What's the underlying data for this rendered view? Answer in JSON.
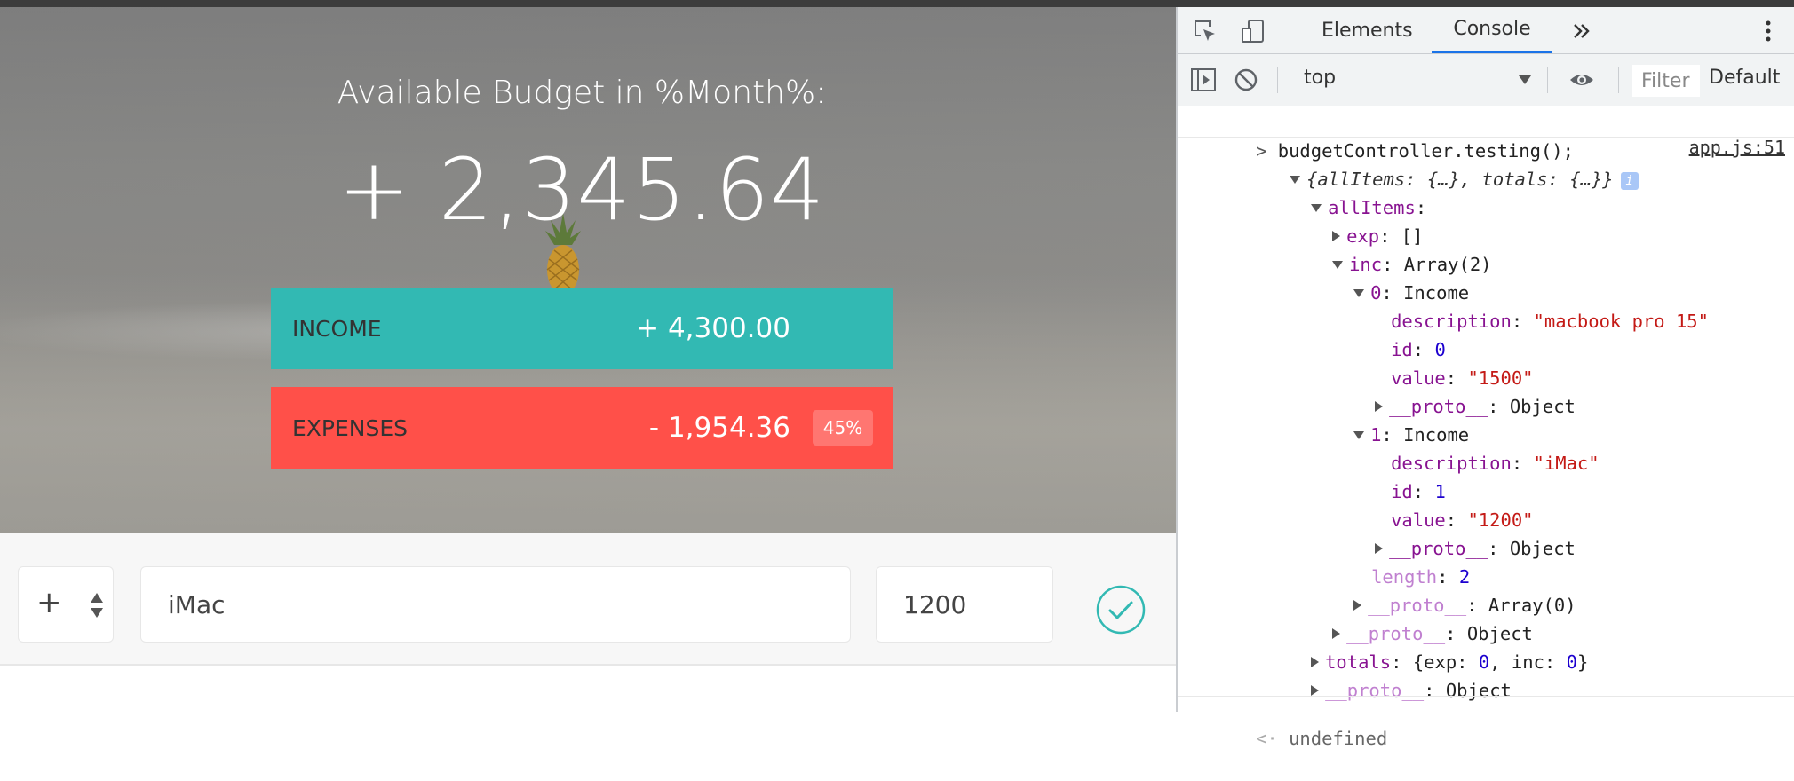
{
  "app": {
    "title": "Available Budget in %Month%:",
    "budget": "+ 2,345.64",
    "income": {
      "label": "Income",
      "value": "+ 4,300.00"
    },
    "expenses": {
      "label": "Expenses",
      "value": "- 1,954.36",
      "percentage": "45%"
    },
    "add": {
      "type_value": "+",
      "description_value": "iMac",
      "amount_value": "1200"
    },
    "colors": {
      "income": "#32b9b3",
      "expenses": "#ff5049"
    }
  },
  "devtools": {
    "tabs": [
      "Elements",
      "Console"
    ],
    "active_tab": "Console",
    "more_tabs_icon": "double-chevron-icon",
    "context": "top",
    "filter_placeholder": "Filter",
    "levels": "Default levels",
    "console": {
      "input": "budgetController.testing();",
      "source_link": "app.js:51",
      "summary": "{allItems: {…}, totals: {…}}",
      "info_badge": "i",
      "lines": {
        "allItems": "allItems",
        "exp_key": "exp",
        "exp_val": "[]",
        "inc_key": "inc",
        "inc_val": "Array(2)",
        "item0_key": "0",
        "item0_val": "Income",
        "item0_desc_key": "description",
        "item0_desc_val": "\"macbook pro 15\"",
        "item0_id_key": "id",
        "item0_id_val": "0",
        "item0_value_key": "value",
        "item0_value_val": "\"1500\"",
        "proto_key": "__proto__",
        "proto_obj": "Object",
        "item1_key": "1",
        "item1_val": "Income",
        "item1_desc_val": "\"iMac\"",
        "item1_id_val": "1",
        "item1_value_val": "\"1200\"",
        "length_key": "length",
        "length_val": "2",
        "proto_arr": "Array(0)",
        "totals_key": "totals",
        "totals_pre": "{exp: ",
        "totals_exp": "0",
        "totals_mid": ", inc: ",
        "totals_inc": "0",
        "totals_post": "}"
      },
      "result": "undefined"
    }
  }
}
